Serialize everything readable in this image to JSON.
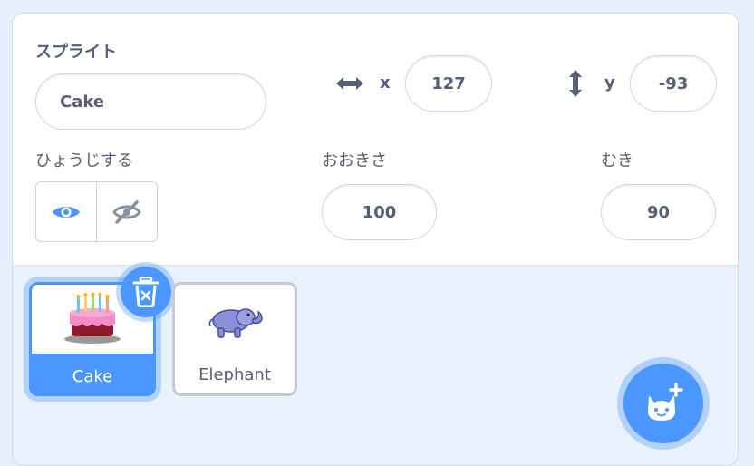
{
  "sprite_info": {
    "sprite_label": "スプライト",
    "sprite_name": "Cake",
    "x_label": "x",
    "x_value": "127",
    "y_label": "y",
    "y_value": "-93",
    "show_label": "ひょうじする",
    "size_label": "おおきさ",
    "size_value": "100",
    "direction_label": "むき",
    "direction_value": "90"
  },
  "sprites": [
    {
      "name": "Cake",
      "selected": true,
      "icon": "cake-icon"
    },
    {
      "name": "Elephant",
      "selected": false,
      "icon": "elephant-icon"
    }
  ],
  "colors": {
    "accent": "#4c97ff",
    "text": "#575e75",
    "panel_bg": "#e9f1fc"
  }
}
